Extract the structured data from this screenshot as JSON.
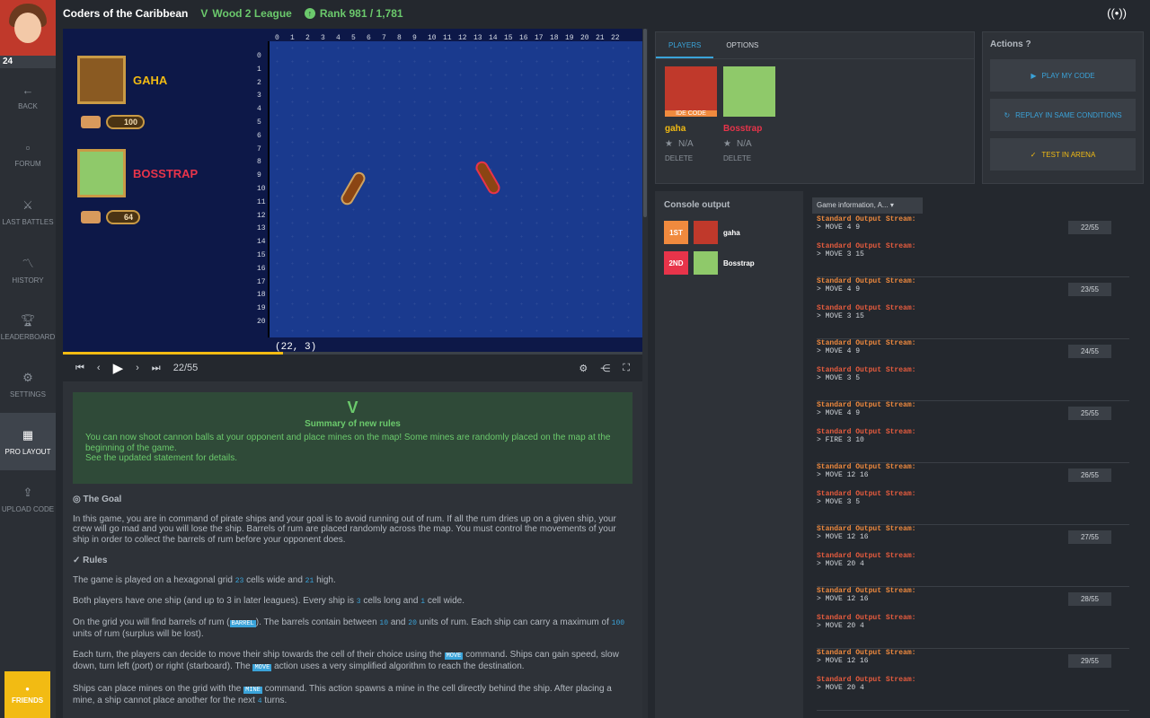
{
  "topbar": {
    "title": "Coders of the Caribbean",
    "league": "Wood 2 League",
    "rank": "Rank 981 / 1,781"
  },
  "user": {
    "level": "24"
  },
  "sidebar": {
    "items": [
      {
        "label": "BACK",
        "icon": "arrow-left-icon"
      },
      {
        "label": "FORUM",
        "icon": "forum-icon"
      },
      {
        "label": "LAST BATTLES",
        "icon": "battles-icon"
      },
      {
        "label": "HISTORY",
        "icon": "history-icon"
      },
      {
        "label": "LEADERBOARD",
        "icon": "trophy-icon"
      },
      {
        "label": "SETTINGS",
        "icon": "gear-icon"
      },
      {
        "label": "PRO LAYOUT",
        "icon": "grid-icon"
      },
      {
        "label": "UPLOAD CODE",
        "icon": "upload-icon"
      }
    ],
    "friends": "FRIENDS"
  },
  "viewer": {
    "col_labels": [
      "0",
      "1",
      "2",
      "3",
      "4",
      "5",
      "6",
      "7",
      "8",
      "9",
      "10",
      "11",
      "12",
      "13",
      "14",
      "15",
      "16",
      "17",
      "18",
      "19",
      "20",
      "21",
      "22"
    ],
    "row_labels": [
      "0",
      "1",
      "2",
      "3",
      "4",
      "5",
      "6",
      "7",
      "8",
      "9",
      "10",
      "11",
      "12",
      "13",
      "14",
      "15",
      "16",
      "17",
      "18",
      "19",
      "20"
    ],
    "p1": {
      "name": "GAHA",
      "rum": "100",
      "color": "#f2bb13"
    },
    "p2": {
      "name": "BOSSTRAP",
      "rum": "64",
      "color": "#e8344a"
    },
    "coord": "(22, 3)"
  },
  "controls": {
    "frame": "22/55",
    "progress": 0.38
  },
  "statement": {
    "summary_title": "Summary of new rules",
    "summary_text": "You can now shoot cannon balls at your opponent and place mines on the map! Some mines are randomly placed on the map at the beginning of the game.",
    "summary_text2": "See the updated statement for details.",
    "goal_title": "The Goal",
    "goal_text": "In this game, you are in command of pirate ships and your goal is to avoid running out of rum. If all the rum dries up on a given ship, your crew will go mad and you will lose the ship. Barrels of rum are placed randomly across the map. You must control the movements of your ship in order to collect the barrels of rum before your opponent does.",
    "rules_title": "Rules",
    "r1a": "The game is played on a hexagonal grid",
    "r1v1": "23",
    "r1b": "cells wide and",
    "r1v2": "21",
    "r1c": "high.",
    "r2a": "Both players have one ship (and up to 3 in later leagues). Every ship is",
    "r2v1": "3",
    "r2b": "cells long and",
    "r2v2": "1",
    "r2c": "cell wide.",
    "r3a": "On the grid you will find barrels of rum (",
    "r3k": "BARREL",
    "r3b": "). The barrels contain between",
    "r3v1": "10",
    "r3c": "and",
    "r3v2": "20",
    "r3d": "units of rum. Each ship can carry a maximum of",
    "r3v3": "100",
    "r3e": "units of rum (surplus will be lost).",
    "r4a": "Each turn, the players can decide to move their ship towards the cell of their choice using the",
    "r4k": "MOVE",
    "r4b": "command. Ships can gain speed, slow down, turn left (port) or right (starboard). The",
    "r4k2": "MOVE",
    "r4c": "action uses a very simplified algorithm to reach the destination.",
    "r5a": "Ships can place mines on the grid with the",
    "r5k": "MINE",
    "r5b": "command. This action spawns a mine in the cell directly behind the ship. After placing a mine, a ship cannot place another for the next",
    "r5v": "4",
    "r5c": "turns."
  },
  "players_panel": {
    "tab1": "PLAYERS",
    "tab2": "OPTIONS",
    "p1": {
      "name": "gaha",
      "score": "N/A",
      "del": "DELETE",
      "tag": "IDE CODE"
    },
    "p2": {
      "name": "Bosstrap",
      "score": "N/A",
      "del": "DELETE"
    }
  },
  "actions": {
    "title": "Actions",
    "play": "PLAY MY CODE",
    "replay": "REPLAY IN SAME CONDITIONS",
    "test": "TEST IN ARENA"
  },
  "console": {
    "title": "Console output",
    "select": "Game information, A...",
    "ranks": [
      {
        "pos": "1ST",
        "name": "gaha"
      },
      {
        "pos": "2ND",
        "name": "Bosstrap"
      }
    ],
    "stream_label": "Standard Output Stream:",
    "turns": [
      {
        "num": "22/55",
        "a": "> MOVE 4 9",
        "b": "> MOVE 3 15"
      },
      {
        "num": "23/55",
        "a": "> MOVE 4 9",
        "b": "> MOVE 3 15"
      },
      {
        "num": "24/55",
        "a": "> MOVE 4 9",
        "b": "> MOVE 3 5"
      },
      {
        "num": "25/55",
        "a": "> MOVE 4 9",
        "b": "> FIRE 3 10"
      },
      {
        "num": "26/55",
        "a": "> MOVE 12 16",
        "b": "> MOVE 3 5"
      },
      {
        "num": "27/55",
        "a": "> MOVE 12 16",
        "b": "> MOVE 20 4"
      },
      {
        "num": "28/55",
        "a": "> MOVE 12 16",
        "b": "> MOVE 20 4"
      },
      {
        "num": "29/55",
        "a": "> MOVE 12 16",
        "b": "> MOVE 20 4"
      }
    ]
  }
}
